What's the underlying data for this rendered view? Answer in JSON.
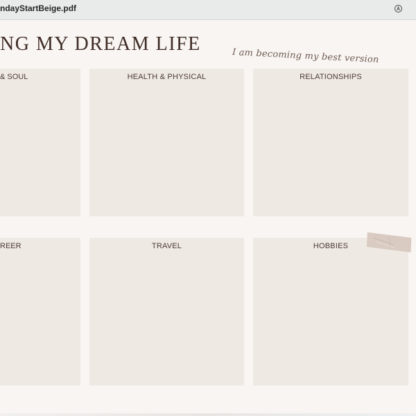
{
  "window": {
    "filename": "ndayStartBeige.pdf"
  },
  "toolbar": {
    "markup_icon": "markup-pen-icon"
  },
  "page": {
    "title": "NG MY DREAM LIFE",
    "tagline": "I am becoming my best version"
  },
  "sections": {
    "mind_soul": "& SOUL",
    "health": "HEALTH & PHYSICAL",
    "relationships": "RELATIONSHIPS",
    "career": "REER",
    "travel": "TRAVEL",
    "hobbies": "HOBBIES"
  },
  "colors": {
    "page_bg": "#f9f5f2",
    "box_bg": "#efe9e3",
    "title_color": "#3f2c26",
    "tape": "#d9cbc1"
  }
}
